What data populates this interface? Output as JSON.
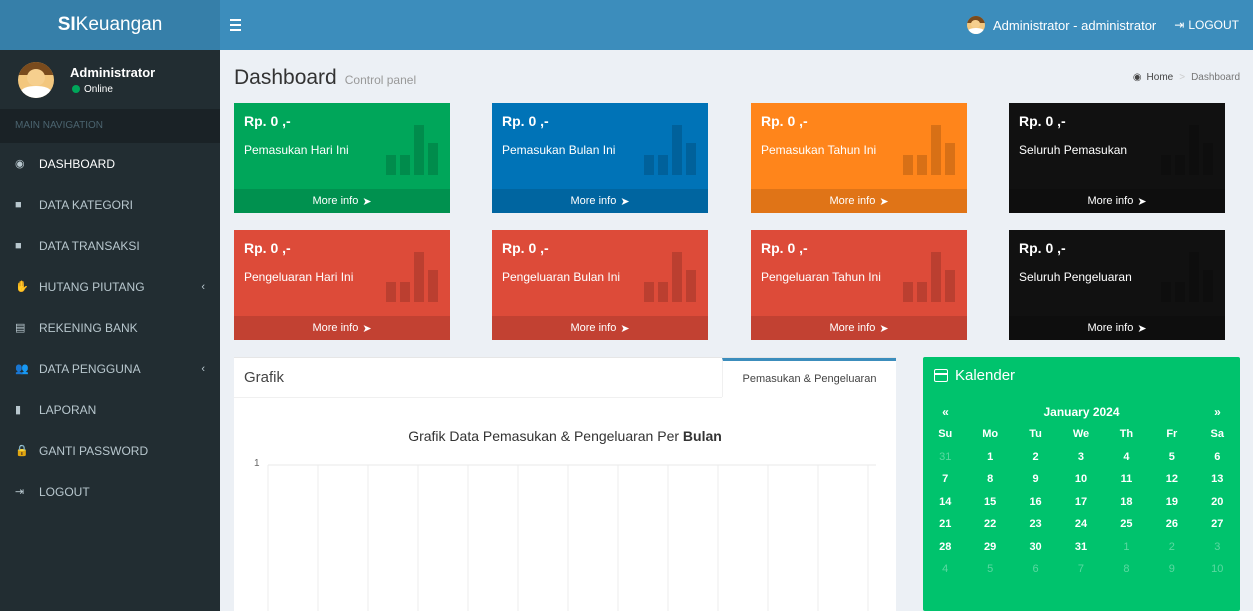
{
  "header": {
    "brand_bold": "SI",
    "brand_rest": "Keuangan",
    "user_label": "Administrator - administrator",
    "logout_label": "LOGOUT"
  },
  "sidebar": {
    "user_name": "Administrator",
    "user_status": "Online",
    "nav_header": "MAIN NAVIGATION",
    "items": [
      {
        "label": "DASHBOARD",
        "icon": "dashboard-icon",
        "glyph": "◉"
      },
      {
        "label": "DATA KATEGORI",
        "icon": "folder-icon",
        "glyph": "■"
      },
      {
        "label": "DATA TRANSAKSI",
        "icon": "folder-icon",
        "glyph": "■"
      },
      {
        "label": "HUTANG PIUTANG",
        "icon": "hand-icon",
        "glyph": "✋"
      },
      {
        "label": "REKENING BANK",
        "icon": "book-icon",
        "glyph": "▤"
      },
      {
        "label": "DATA PENGGUNA",
        "icon": "users-icon",
        "glyph": "👥"
      },
      {
        "label": "LAPORAN",
        "icon": "file-icon",
        "glyph": "▮"
      },
      {
        "label": "GANTI PASSWORD",
        "icon": "lock-icon",
        "glyph": "🔒"
      },
      {
        "label": "LOGOUT",
        "icon": "sign-out-icon",
        "glyph": "⇥"
      }
    ]
  },
  "content": {
    "title": "Dashboard",
    "subtitle": "Control panel",
    "breadcrumb_home": "Home",
    "breadcrumb_current": "Dashboard"
  },
  "boxes": [
    {
      "amount": "Rp. 0 ,-",
      "label": "Pemasukan Hari Ini",
      "more": "More info",
      "color": "#00a65a"
    },
    {
      "amount": "Rp. 0 ,-",
      "label": "Pemasukan Bulan Ini",
      "more": "More info",
      "color": "#0073b7"
    },
    {
      "amount": "Rp. 0 ,-",
      "label": "Pemasukan Tahun Ini",
      "more": "More info",
      "color": "#ff851b"
    },
    {
      "amount": "Rp. 0 ,-",
      "label": "Seluruh Pemasukan",
      "more": "More info",
      "color": "#111111"
    },
    {
      "amount": "Rp. 0 ,-",
      "label": "Pengeluaran Hari Ini",
      "more": "More info",
      "color": "#dd4b39"
    },
    {
      "amount": "Rp. 0 ,-",
      "label": "Pengeluaran Bulan Ini",
      "more": "More info",
      "color": "#dd4b39"
    },
    {
      "amount": "Rp. 0 ,-",
      "label": "Pengeluaran Tahun Ini",
      "more": "More info",
      "color": "#dd4b39"
    },
    {
      "amount": "Rp. 0 ,-",
      "label": "Seluruh Pengeluaran",
      "more": "More info",
      "color": "#111111"
    }
  ],
  "grafik": {
    "title": "Grafik",
    "tab_label": "Pemasukan & Pengeluaran",
    "chart_title_prefix": "Grafik Data Pemasukan & Pengeluaran Per",
    "chart_title_bold": "Bulan",
    "y_tick": "1"
  },
  "kalender": {
    "title": "Kalender",
    "prev": "«",
    "next": "»",
    "month": "January 2024",
    "weekdays": [
      "Su",
      "Mo",
      "Tu",
      "We",
      "Th",
      "Fr",
      "Sa"
    ],
    "weeks": [
      [
        {
          "d": "31",
          "m": true
        },
        {
          "d": "1"
        },
        {
          "d": "2"
        },
        {
          "d": "3"
        },
        {
          "d": "4"
        },
        {
          "d": "5"
        },
        {
          "d": "6"
        }
      ],
      [
        {
          "d": "7"
        },
        {
          "d": "8"
        },
        {
          "d": "9"
        },
        {
          "d": "10"
        },
        {
          "d": "11"
        },
        {
          "d": "12"
        },
        {
          "d": "13"
        }
      ],
      [
        {
          "d": "14"
        },
        {
          "d": "15"
        },
        {
          "d": "16"
        },
        {
          "d": "17"
        },
        {
          "d": "18"
        },
        {
          "d": "19"
        },
        {
          "d": "20"
        }
      ],
      [
        {
          "d": "21"
        },
        {
          "d": "22"
        },
        {
          "d": "23"
        },
        {
          "d": "24"
        },
        {
          "d": "25"
        },
        {
          "d": "26"
        },
        {
          "d": "27"
        }
      ],
      [
        {
          "d": "28"
        },
        {
          "d": "29"
        },
        {
          "d": "30"
        },
        {
          "d": "31"
        },
        {
          "d": "1",
          "m": true
        },
        {
          "d": "2",
          "m": true
        },
        {
          "d": "3",
          "m": true
        }
      ],
      [
        {
          "d": "4",
          "m": true
        },
        {
          "d": "5",
          "m": true
        },
        {
          "d": "6",
          "m": true
        },
        {
          "d": "7",
          "m": true
        },
        {
          "d": "8",
          "m": true
        },
        {
          "d": "9",
          "m": true
        },
        {
          "d": "10",
          "m": true
        }
      ]
    ]
  },
  "colors": {
    "header_blue": "#3c8dbc",
    "logo_blue": "#367fa9",
    "sidebar_dark": "#222d32",
    "calendar_green": "#00c36d"
  }
}
